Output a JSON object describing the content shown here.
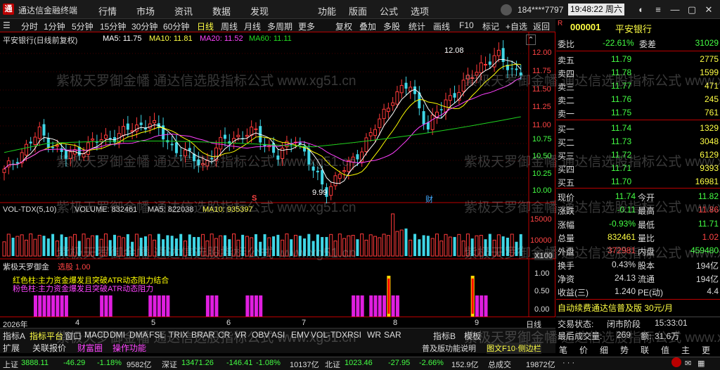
{
  "titlebar": {
    "app_title": "通达信金融终端",
    "menu": [
      "行情",
      "市场",
      "资讯",
      "数据",
      "发现",
      "功能",
      "版面",
      "公式",
      "选项"
    ],
    "phone": "184****7797",
    "clock": "19:48:22 周六"
  },
  "toolbar": {
    "items": [
      "分时",
      "1分钟",
      "5分钟",
      "15分钟",
      "30分钟",
      "60分钟",
      "日线",
      "周线",
      "月线",
      "多周期",
      "更多",
      "复权",
      "叠加",
      "多股",
      "统计",
      "画线",
      "F10",
      "标记",
      "+自选",
      "返回"
    ],
    "active": "日线"
  },
  "main_chart": {
    "header": {
      "stock": "平安银行(日线前复权)",
      "ma5": "MA5: 11.75",
      "ma10": "MA10: 11.81",
      "ma20": "MA20: 11.52",
      "ma60": "MA60: 11.11"
    },
    "price_ticks": [
      "12.00",
      "11.75",
      "11.50",
      "11.25",
      "11.00",
      "10.75",
      "10.50",
      "10.25",
      "10.00"
    ],
    "high_label": "12.08",
    "low_label": "9.99",
    "marker_s": "S",
    "marker_cai": "财"
  },
  "volume_chart": {
    "header": {
      "name": "VOL-TDX(5,10)",
      "volume": "VOLUME: 832461",
      "ma5": "MA5: 822038",
      "ma10": "MA10: 935397"
    },
    "ticks": [
      "15000",
      "10000",
      "5000"
    ],
    "unit": "X100"
  },
  "indicator_chart": {
    "header": {
      "name": "紫极天罗御金",
      "extra": "选股 1.00"
    },
    "legend1": "红色柱:主力资金爆发且突破ATR动态阻力结合",
    "legend2": "粉色柱:主力资金爆发且突破ATR动态阻力",
    "ticks": [
      "1.00",
      "0.50",
      "0.00"
    ]
  },
  "date_axis": {
    "year": "2026年",
    "months": [
      "4",
      "5",
      "6",
      "7",
      "8",
      "9"
    ],
    "period": "日线"
  },
  "bottom_tabs1": [
    "指标A",
    "指标平台",
    "窗口",
    "MACD",
    "DMI",
    "DMA",
    "FSL",
    "TRIX",
    "BRAR",
    "CR",
    "VR",
    "OBV",
    "ASI",
    "EMV",
    "VOL-TDX",
    "RSI",
    "WR",
    "SAR",
    "指标B",
    "模板"
  ],
  "bottom_tabs2": [
    "扩展",
    "关联报价",
    "财富圈",
    "操作功能"
  ],
  "right_panel": {
    "code": "000001",
    "name": "平安银行",
    "weibi_label": "委比",
    "weibi": "-22.61%",
    "weicha_label": "委差",
    "weicha": "31029",
    "asks": [
      {
        "label": "卖五",
        "price": "11.79",
        "vol": "2775"
      },
      {
        "label": "卖四",
        "price": "11.78",
        "vol": "1599"
      },
      {
        "label": "卖三",
        "price": "11.77",
        "vol": "471"
      },
      {
        "label": "卖二",
        "price": "11.76",
        "vol": "245"
      },
      {
        "label": "卖一",
        "price": "11.75",
        "vol": "761"
      }
    ],
    "bids": [
      {
        "label": "买一",
        "price": "11.74",
        "vol": "1329"
      },
      {
        "label": "买二",
        "price": "11.73",
        "vol": "3048"
      },
      {
        "label": "买三",
        "price": "11.72",
        "vol": "6129"
      },
      {
        "label": "买四",
        "price": "11.71",
        "vol": "9393"
      },
      {
        "label": "买五",
        "price": "11.70",
        "vol": "16981"
      }
    ],
    "stats": [
      {
        "l1": "现价",
        "v1": "11.74",
        "l2": "今开",
        "v2": "11.82",
        "c1": "#4f4",
        "c2": "#4f4"
      },
      {
        "l1": "涨跌",
        "v1": "-0.11",
        "l2": "最高",
        "v2": "11.86",
        "c1": "#4f4",
        "c2": "#f44"
      },
      {
        "l1": "涨幅",
        "v1": "-0.93%",
        "l2": "最低",
        "v2": "11.71",
        "c1": "#4f4",
        "c2": "#4f4"
      },
      {
        "l1": "总量",
        "v1": "832461",
        "l2": "量比",
        "v2": "1.02",
        "c1": "#ff4",
        "c2": "#f44"
      },
      {
        "l1": "外盘",
        "v1": "372981",
        "l2": "内盘",
        "v2": "459480",
        "c1": "#f44",
        "c2": "#4f4"
      },
      {
        "l1": "换手",
        "v1": "0.43%",
        "l2": "股本",
        "v2": "194亿",
        "c1": "#ddd",
        "c2": "#ddd"
      },
      {
        "l1": "净资",
        "v1": "24.13",
        "l2": "流通",
        "v2": "194亿",
        "c1": "#ddd",
        "c2": "#ddd"
      },
      {
        "l1": "收益(三)",
        "v1": "1.240",
        "l2": "PE(动)",
        "v2": "4.4",
        "c1": "#ddd",
        "c2": "#ddd"
      }
    ],
    "promo": "自动续费通达信普及版 30元/月",
    "trade_status_label": "交易状态:",
    "trade_status": "闭市阶段",
    "trade_time": "15:33:01",
    "last_vol_label": "最后成交量:",
    "last_vol": "269",
    "amount_label": "额:",
    "amount": "31.6万",
    "tabs": [
      "笔",
      "价",
      "细",
      "势",
      "联",
      "值",
      "主",
      "更"
    ]
  },
  "statusbar": {
    "sh_label": "上证",
    "sh": "3888.11",
    "sh_chg": "-46.29",
    "sh_pct": "-1.18%",
    "sh_amt": "9582亿",
    "sz_label": "深证",
    "sz": "13471.26",
    "sz_chg": "-146.41",
    "sz_pct": "-1.08%",
    "sz_amt": "10137亿",
    "bz_label": "北证",
    "bz": "1023.46",
    "bz_chg": "-27.95",
    "bz_pct": "-2.66%",
    "bz_amt": "152.9亿",
    "total_label": "总成交",
    "total": "19872亿",
    "tips": "普及版功能说明",
    "f10": "图文F10·侧边栏"
  },
  "watermark": "紫极天罗御金幡 通达信选股指标公式 www.xg51.cn",
  "colors": {
    "up": "#ff3a3a",
    "down": "#3fd6e6",
    "ma5": "#ffffff",
    "ma10": "#ffff00",
    "ma20": "#ff40ff",
    "ma60": "#1fd11f",
    "accent": "#b00000"
  }
}
